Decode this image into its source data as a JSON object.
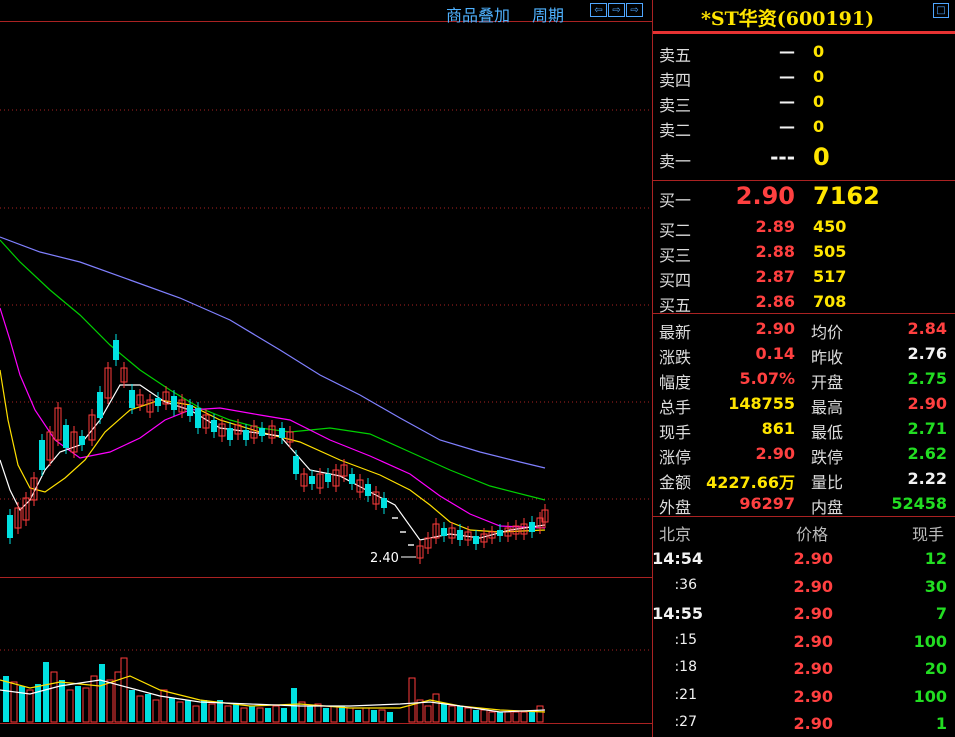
{
  "toolbar": {
    "overlay_label": "商品叠加",
    "period_label": "周期",
    "arrow_left": "⇦",
    "arrow_right": "⇨",
    "arrow_dock": "⇨"
  },
  "stock": {
    "title": "*ST华资(600191)",
    "window_icon": "window-icon"
  },
  "chart": {
    "low_marker": "2.40"
  },
  "asks": [
    {
      "label": "卖五",
      "price": "—",
      "vol": "0"
    },
    {
      "label": "卖四",
      "price": "—",
      "vol": "0"
    },
    {
      "label": "卖三",
      "price": "—",
      "vol": "0"
    },
    {
      "label": "卖二",
      "price": "—",
      "vol": "0"
    },
    {
      "label": "卖一",
      "price": "---",
      "vol": "0"
    }
  ],
  "bids": [
    {
      "label": "买一",
      "price": "2.90",
      "vol": "7162"
    },
    {
      "label": "买二",
      "price": "2.89",
      "vol": "450"
    },
    {
      "label": "买三",
      "price": "2.88",
      "vol": "505"
    },
    {
      "label": "买四",
      "price": "2.87",
      "vol": "517"
    },
    {
      "label": "买五",
      "price": "2.86",
      "vol": "708"
    }
  ],
  "stats": [
    {
      "l1": "最新",
      "v1": "2.90",
      "l2": "均价",
      "v2": "2.84"
    },
    {
      "l1": "涨跌",
      "v1": "0.14",
      "l2": "昨收",
      "v2": "2.76"
    },
    {
      "l1": "幅度",
      "v1": "5.07%",
      "l2": "开盘",
      "v2": "2.75"
    },
    {
      "l1": "总手",
      "v1": "148755",
      "l2": "最高",
      "v2": "2.90"
    },
    {
      "l1": "现手",
      "v1": "861",
      "l2": "最低",
      "v2": "2.71"
    },
    {
      "l1": "涨停",
      "v1": "2.90",
      "l2": "跌停",
      "v2": "2.62"
    },
    {
      "l1": "金额",
      "v1": "4227.66万",
      "l2": "量比",
      "v2": "2.22"
    },
    {
      "l1": "外盘",
      "v1": "96297",
      "l2": "内盘",
      "v2": "52458"
    }
  ],
  "ticks_header": {
    "col1": "北京",
    "col2": "价格",
    "col3": "现手"
  },
  "ticks": [
    {
      "time": "14:54",
      "price": "2.90",
      "vol": "12"
    },
    {
      "time": ":36",
      "price": "2.90",
      "vol": "30"
    },
    {
      "time": "14:55",
      "price": "2.90",
      "vol": "7"
    },
    {
      "time": ":15",
      "price": "2.90",
      "vol": "100"
    },
    {
      "time": ":18",
      "price": "2.90",
      "vol": "20"
    },
    {
      "time": ":21",
      "price": "2.90",
      "vol": "100"
    },
    {
      "time": ":27",
      "price": "2.90",
      "vol": "1"
    }
  ],
  "colors": {
    "up": "#ff3c3c",
    "down": "#00e0e0",
    "ma5": "#ffffff",
    "ma10": "#ffe000",
    "ma20": "#ff00ff",
    "ma30": "#00d000",
    "ma60": "#8080ff",
    "grid": "#aa2222"
  }
}
